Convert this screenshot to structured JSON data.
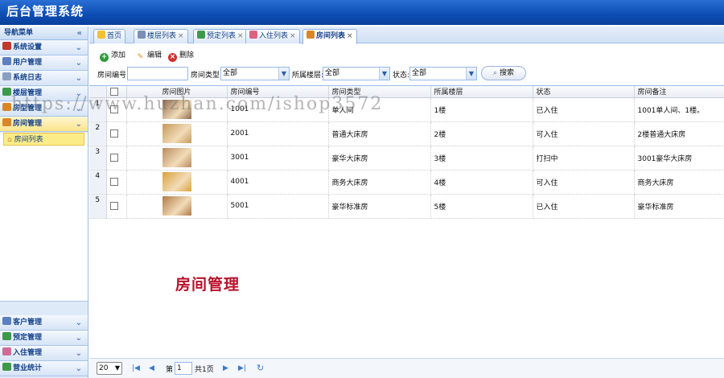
{
  "app": {
    "title": "后台管理系统"
  },
  "sidebar": {
    "title": "导航菜单",
    "items": [
      {
        "label": "系统设置",
        "color": "#c0392b"
      },
      {
        "label": "用户管理",
        "color": "#5b7fbf"
      },
      {
        "label": "系统日志",
        "color": "#8aa0c0"
      },
      {
        "label": "楼层管理",
        "color": "#3d9a4a"
      },
      {
        "label": "房型管理",
        "color": "#d9862b"
      },
      {
        "label": "房间管理",
        "color": "#d9862b"
      }
    ],
    "sub_items": [
      {
        "label": "房间列表"
      }
    ],
    "bottom_items": [
      {
        "label": "客户管理",
        "color": "#5b7fbf"
      },
      {
        "label": "预定管理",
        "color": "#3d9a4a"
      },
      {
        "label": "入住管理",
        "color": "#d06a9a"
      },
      {
        "label": "营业统计",
        "color": "#3d9a4a"
      }
    ]
  },
  "tabs": [
    {
      "label": "首页",
      "icon": "lightbulb-icon",
      "color": "#f1c232",
      "closable": false
    },
    {
      "label": "楼层列表",
      "icon": "building-icon",
      "color": "#7a90b5",
      "closable": true
    },
    {
      "label": "预定列表",
      "icon": "clock-icon",
      "color": "#3d9a4a",
      "closable": true
    },
    {
      "label": "入住列表",
      "icon": "heart-icon",
      "color": "#e06080",
      "closable": true
    },
    {
      "label": "房间列表",
      "icon": "house-icon",
      "color": "#d9862b",
      "closable": true
    }
  ],
  "toolbar": {
    "add": "添加",
    "edit": "编辑",
    "delete": "删除"
  },
  "search": {
    "room_no_label": "房间编号:",
    "room_no_value": "",
    "type_label": "房间类型:",
    "type_value": "全部",
    "floor_label": "所属楼层:",
    "floor_value": "全部",
    "status_label": "状态:",
    "status_value": "全部",
    "button": "搜索"
  },
  "table": {
    "columns": [
      "房间图片",
      "房间编号",
      "房间类型",
      "所属楼层",
      "状态",
      "房间备注"
    ],
    "rows": [
      {
        "row_num": "1",
        "room_no": "1001",
        "type": "单人间",
        "floor": "1楼",
        "status": "已入住",
        "note": "1001单人间、1楼。",
        "thumb": "#8f6a4e"
      },
      {
        "row_num": "2",
        "room_no": "2001",
        "type": "普通大床房",
        "floor": "2楼",
        "status": "可入住",
        "note": "2楼普通大床房",
        "thumb": "#c49a5a"
      },
      {
        "row_num": "3",
        "room_no": "3001",
        "type": "豪华大床房",
        "floor": "3楼",
        "status": "打扫中",
        "note": "3001豪华大床房",
        "thumb": "#b98b5e"
      },
      {
        "row_num": "4",
        "room_no": "4001",
        "type": "商务大床房",
        "floor": "4楼",
        "status": "可入住",
        "note": "商务大床房",
        "thumb": "#d9a23c"
      },
      {
        "row_num": "5",
        "room_no": "5001",
        "type": "豪华标准房",
        "floor": "5楼",
        "status": "已入住",
        "note": "豪华标准房",
        "thumb": "#b07a48"
      }
    ]
  },
  "pager": {
    "page_size": "20",
    "page_label": "第",
    "page_value": "1",
    "total_pages": "共1页"
  },
  "watermark": "https://www.huzhan.com/ishop3572",
  "caption": "房间管理"
}
